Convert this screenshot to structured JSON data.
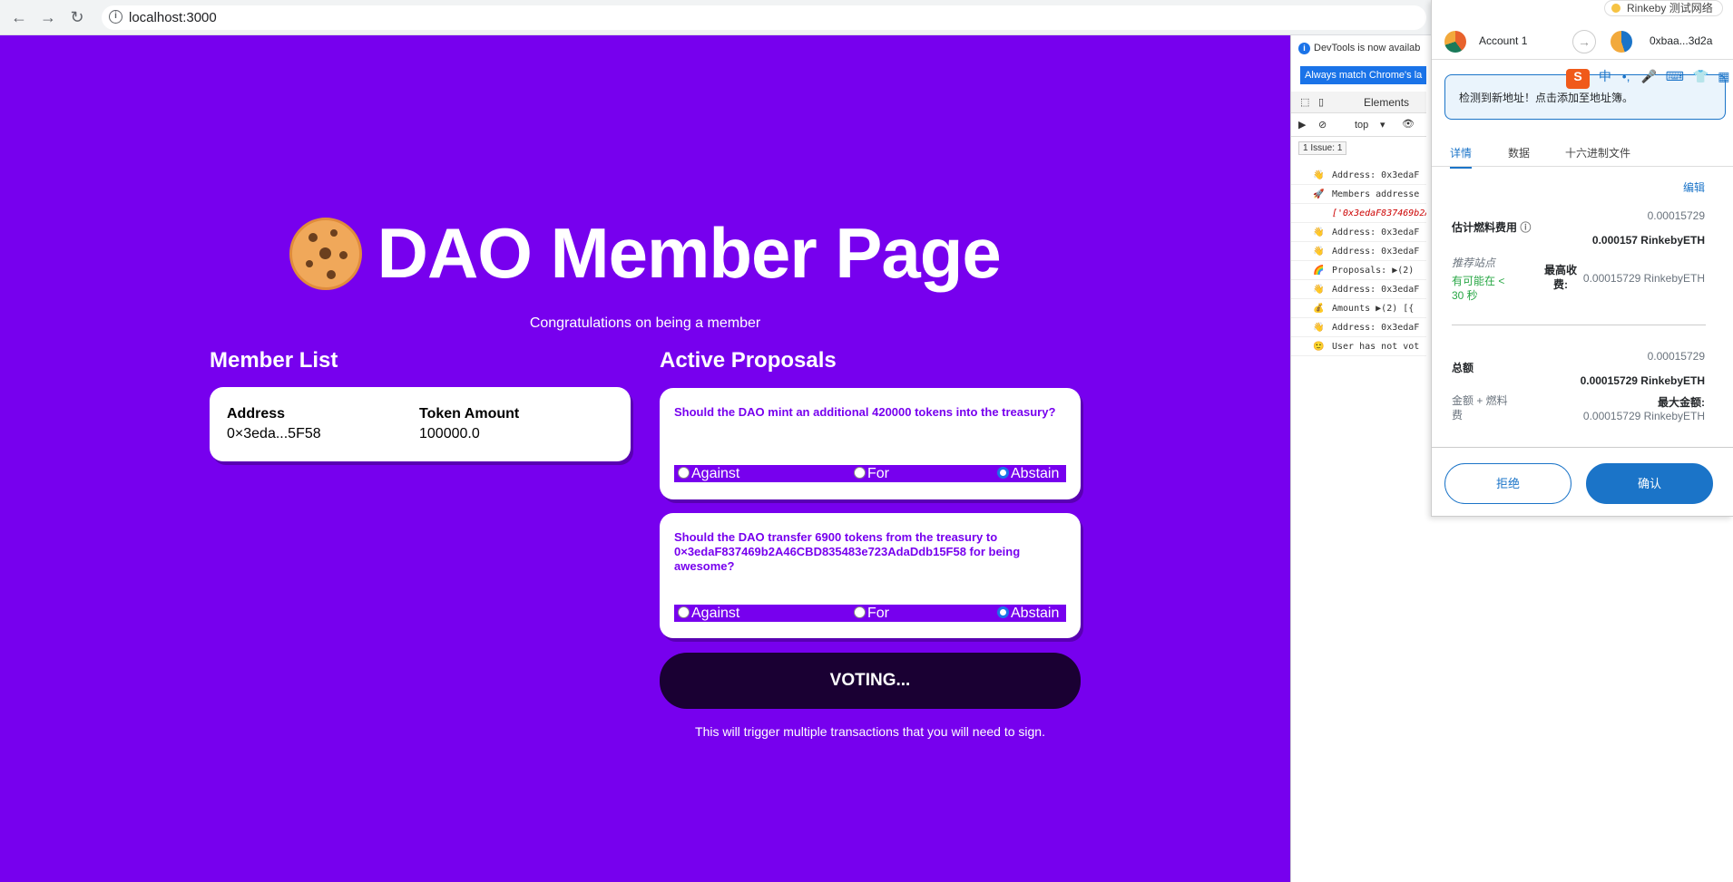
{
  "browser": {
    "url": "localhost:3000"
  },
  "page": {
    "title": "DAO Member Page",
    "subtitle": "Congratulations on being a member",
    "member_list": {
      "heading": "Member List",
      "columns": [
        "Address",
        "Token Amount"
      ],
      "rows": [
        {
          "address": "0×3eda...5F58",
          "amount": "100000.0"
        }
      ]
    },
    "proposals": {
      "heading": "Active Proposals",
      "items": [
        {
          "question": "Should the DAO mint an additional 420000 tokens into the treasury?",
          "options": [
            "Against",
            "For",
            "Abstain"
          ],
          "selected": "Abstain"
        },
        {
          "question": "Should the DAO transfer 6900 tokens from the treasury to 0×3edaF837469b2A46CBD835483e723AdaDdb15F58 for being awesome?",
          "options": [
            "Against",
            "For",
            "Abstain"
          ],
          "selected": "Abstain"
        }
      ]
    },
    "vote_button": "VOTING...",
    "hint": "This will trigger multiple transactions that you will need to sign."
  },
  "devtools": {
    "info": "DevTools is now availab",
    "match_button": "Always match Chrome's la",
    "tab": "Elements",
    "context": "top",
    "issue": "1 Issue:",
    "issue_count": "1",
    "logs": [
      {
        "emoji": "👋",
        "text": "Address: 0x3edaF"
      },
      {
        "emoji": "🚀",
        "text": "Members addresse"
      },
      {
        "emoji": "",
        "text": "['0x3edaF837469b2A"
      },
      {
        "emoji": "👋",
        "text": "Address: 0x3edaF"
      },
      {
        "emoji": "👋",
        "text": "Address: 0x3edaF"
      },
      {
        "emoji": "🌈",
        "text": "Proposals: ▶(2)"
      },
      {
        "emoji": "👋",
        "text": "Address: 0x3edaF"
      },
      {
        "emoji": "💰",
        "text": "Amounts ▶(2) [{"
      },
      {
        "emoji": "👋",
        "text": "Address: 0x3edaF"
      },
      {
        "emoji": "🙂",
        "text": "User has not vot"
      }
    ]
  },
  "metamask": {
    "network": "Rinkeby 测试网络",
    "account": "Account 1",
    "to_address": "0xbaa...3d2a",
    "notice": "检测到新地址！点击添加至地址簿。",
    "tabs": [
      "详情",
      "数据",
      "十六进制文件"
    ],
    "edit": "编辑",
    "gas": {
      "label": "估计燃料费用",
      "value_small": "0.00015729",
      "value_main": "0.000157 RinkebyETH",
      "site_label": "推荐站点",
      "likely": "有可能在 < 30 秒",
      "max_fee_label": "最高收费:",
      "max_fee_value": "0.00015729 RinkebyETH"
    },
    "total": {
      "label": "总额",
      "value_small": "0.00015729",
      "value_main": "0.00015729 RinkebyETH",
      "amount_label": "金额 + 燃料费",
      "max_label": "最大金额:",
      "max_value": "0.00015729 RinkebyETH"
    },
    "reject": "拒绝",
    "confirm": "确认"
  }
}
